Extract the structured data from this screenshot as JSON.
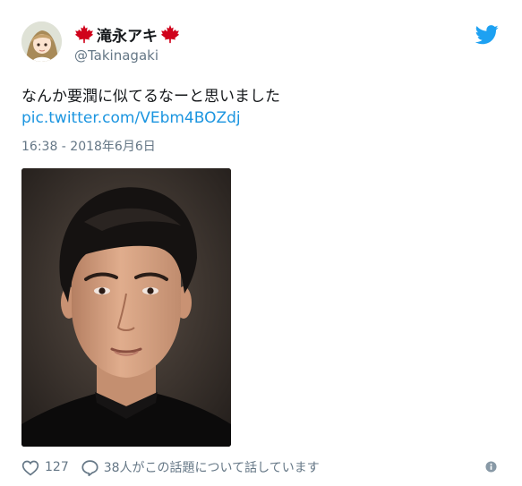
{
  "author": {
    "display_name": "滝永アキ",
    "handle": "@Takinagaki",
    "name_decoration_icon": "maple-leaf-icon",
    "avatar_icon": "anime-avatar"
  },
  "brand": {
    "icon": "twitter-bird-icon",
    "color": "#1da1f2"
  },
  "tweet": {
    "text": "なんか要潤に似てるなーと思いました",
    "link": "pic.twitter.com/VEbm4BOZdj",
    "timestamp": "16:38 - 2018年6月6日",
    "media_icon": "photo-of-man"
  },
  "actions": {
    "like_icon": "heart-icon",
    "like_count": "127",
    "reply_icon": "speech-bubble-icon",
    "reply_text": "38人がこの話題について話しています",
    "info_icon": "info-icon"
  },
  "colors": {
    "text": "#14171a",
    "secondary": "#657786",
    "link": "#1b95e0",
    "leaf": "#d0021b"
  }
}
